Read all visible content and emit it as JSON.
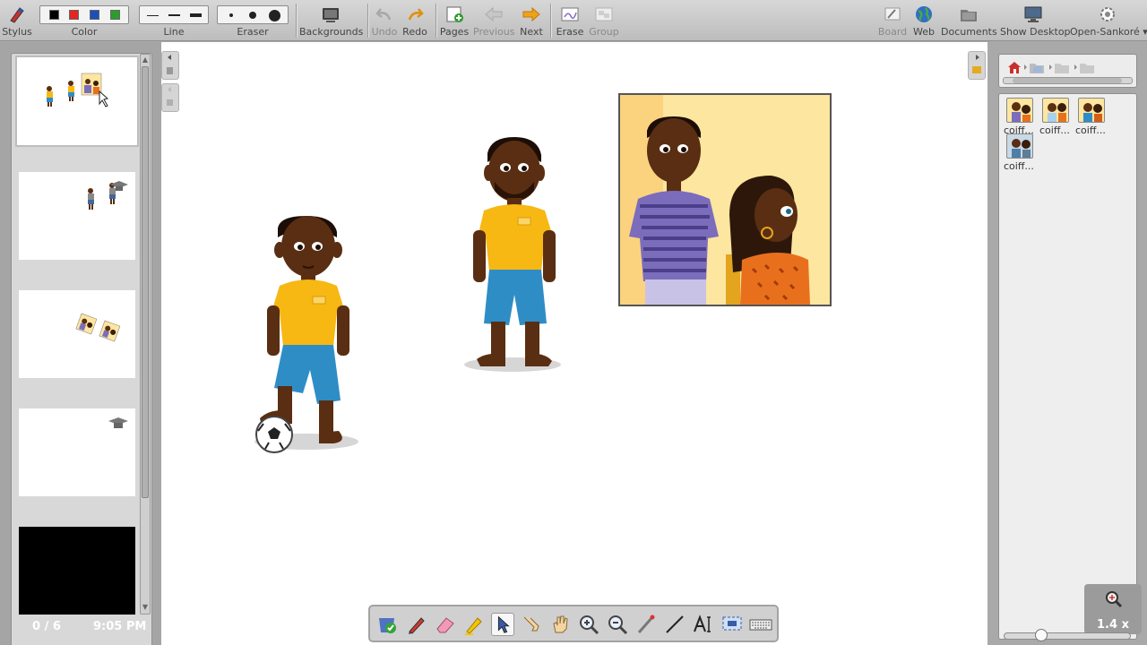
{
  "toolbar": {
    "stylus": "Stylus",
    "color": "Color",
    "line": "Line",
    "eraser": "Eraser",
    "backgrounds": "Backgrounds",
    "undo": "Undo",
    "redo": "Redo",
    "pages": "Pages",
    "previous": "Previous",
    "next": "Next",
    "erase": "Erase",
    "group": "Group",
    "board": "Board",
    "web": "Web",
    "documents": "Documents",
    "show_desktop": "Show Desktop",
    "open_sankore": "Open-Sankoré ▾"
  },
  "colors": {
    "swatches": [
      "#000000",
      "#e52521",
      "#1d4fb8",
      "#2a9e2a"
    ],
    "skin": "#5a2e12",
    "shirt_yellow": "#f7b814",
    "shorts_blue": "#2f8dc6",
    "poster_bg": "#fde6a0"
  },
  "status": {
    "page_count": "0 / 6",
    "time": "9:05 PM"
  },
  "library": {
    "items": [
      {
        "label": "coiff..."
      },
      {
        "label": "coiff..."
      },
      {
        "label": "coiff..."
      },
      {
        "label": "coiff..."
      }
    ]
  },
  "zoom": {
    "value": "1.4 x"
  }
}
